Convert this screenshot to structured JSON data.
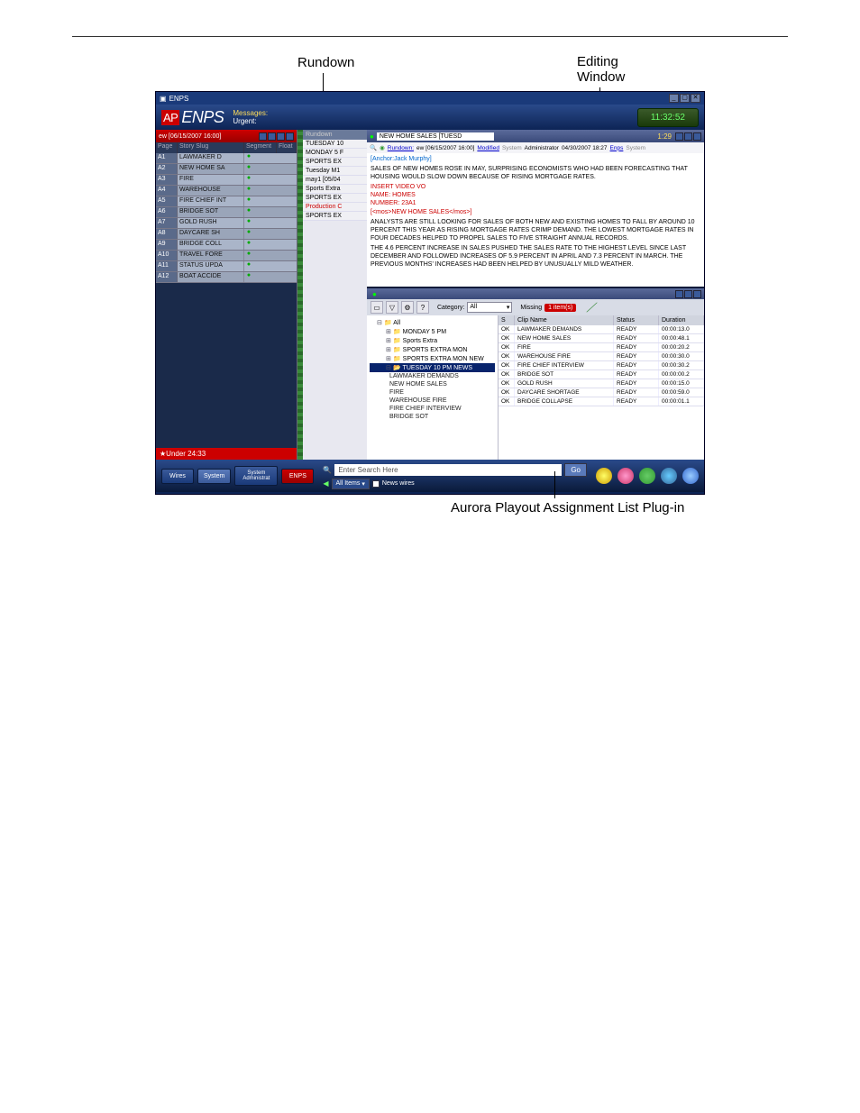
{
  "callouts": {
    "rundown": "Rundown",
    "editing_l1": "Editing",
    "editing_l2": "Window",
    "plugin": "Aurora Playout Assignment List Plug-in"
  },
  "titlebar": {
    "app": "ENPS"
  },
  "appbar": {
    "logo_ap": "AP",
    "logo_enps": "ENPS",
    "messages_label": "Messages:",
    "urgent_label": "Urgent:",
    "clock": "11:32:52"
  },
  "rundown": {
    "header": "ew [06/15/2007 16:00]",
    "cols": {
      "page": "Page",
      "slug": "Story Slug",
      "segment": "Segment",
      "float": "Float"
    },
    "rows": [
      {
        "page": "A1",
        "slug": "LAWMAKER D"
      },
      {
        "page": "A2",
        "slug": "NEW HOME SA"
      },
      {
        "page": "A3",
        "slug": "FIRE"
      },
      {
        "page": "A4",
        "slug": "WAREHOUSE"
      },
      {
        "page": "A5",
        "slug": "FIRE CHIEF INT"
      },
      {
        "page": "A6",
        "slug": "BRIDGE SOT"
      },
      {
        "page": "A7",
        "slug": "GOLD RUSH"
      },
      {
        "page": "A8",
        "slug": "DAYCARE SH"
      },
      {
        "page": "A9",
        "slug": "BRIDGE COLL"
      },
      {
        "page": "A10",
        "slug": "TRAVEL FORE"
      },
      {
        "page": "A11",
        "slug": "STATUS UPDA"
      },
      {
        "page": "A12",
        "slug": "BOAT ACCIDE"
      }
    ],
    "under": "Under 24:33"
  },
  "sidelist": {
    "head": "Rundown",
    "items": [
      {
        "label": "TUESDAY 10",
        "red": false
      },
      {
        "label": "MONDAY 5 F",
        "red": false
      },
      {
        "label": "SPORTS EX",
        "red": false
      },
      {
        "label": "Tuesday M1",
        "red": false
      },
      {
        "label": "may1 [05/04",
        "red": false
      },
      {
        "label": "Sports Extra",
        "red": false
      },
      {
        "label": "SPORTS EX",
        "red": false
      },
      {
        "label": "Production C",
        "red": true
      },
      {
        "label": "SPORTS EX",
        "red": false
      }
    ]
  },
  "editor": {
    "title": "NEW HOME SALES [TUESD",
    "duration": "1:29",
    "meta": {
      "rundowns": "Rundown:",
      "path": "ew [06/15/2007 16:00]",
      "modified": "Modified",
      "system": "System",
      "admin": "Administrator",
      "date": "04/30/2007 18:27",
      "enps": "Enps",
      "sys2": "System"
    },
    "anchor": "[Anchor:Jack Murphy]",
    "p1": "SALES OF NEW HOMES ROSE IN MAY, SURPRISING ECONOMISTS WHO HAD BEEN FORECASTING THAT HOUSING WOULD SLOW DOWN BECAUSE OF RISING MORTGAGE RATES.",
    "cue1": "INSERT VIDEO VO",
    "cue2": "NAME: HOMES",
    "cue3": "NUMBER: 23A1",
    "cue4": "[<mos>NEW HOME SALES</mos>]",
    "p2": "ANALYSTS ARE STILL LOOKING FOR SALES OF BOTH NEW AND EXISTING HOMES TO FALL BY AROUND 10 PERCENT THIS YEAR AS RISING MORTGAGE RATES CRIMP DEMAND. THE LOWEST MORTGAGE RATES IN FOUR DECADES HELPED TO PROPEL SALES TO FIVE STRAIGHT ANNUAL RECORDS.",
    "p3": "THE 4.6 PERCENT INCREASE IN SALES PUSHED THE SALES RATE TO THE HIGHEST LEVEL SINCE LAST DECEMBER AND FOLLOWED INCREASES OF 5.9 PERCENT IN APRIL AND 7.3 PERCENT IN MARCH. THE PREVIOUS MONTHS' INCREASES HAD BEEN HELPED BY UNUSUALLY MILD WEATHER."
  },
  "plugin": {
    "category_label": "Category:",
    "category_value": "All",
    "missing_label": "Missing",
    "missing_value": "1 item(s)",
    "tree": {
      "root": "All",
      "folders": [
        "MONDAY 5 PM",
        "Sports Extra",
        "SPORTS EXTRA MON",
        "SPORTS EXTRA MON NEW"
      ],
      "selected": "TUESDAY 10 PM NEWS",
      "children": [
        "LAWMAKER DEMANDS",
        "NEW HOME SALES",
        "FIRE",
        "WAREHOUSE FIRE",
        "FIRE CHIEF INTERVIEW",
        "BRIDGE SOT"
      ]
    },
    "cols": {
      "s": "S",
      "name": "Clip Name",
      "status": "Status",
      "duration": "Duration"
    },
    "clips": [
      {
        "s": "OK",
        "name": "LAWMAKER DEMANDS",
        "status": "READY",
        "dur": "00:00:13.0"
      },
      {
        "s": "OK",
        "name": "NEW HOME SALES",
        "status": "READY",
        "dur": "00:00:48.1"
      },
      {
        "s": "OK",
        "name": "FIRE",
        "status": "READY",
        "dur": "00:00:20.2"
      },
      {
        "s": "OK",
        "name": "WAREHOUSE FIRE",
        "status": "READY",
        "dur": "00:00:30.0"
      },
      {
        "s": "OK",
        "name": "FIRE CHIEF INTERVIEW",
        "status": "READY",
        "dur": "00:00:30.2"
      },
      {
        "s": "OK",
        "name": "BRIDGE SOT",
        "status": "READY",
        "dur": "00:00:00.2"
      },
      {
        "s": "OK",
        "name": "GOLD RUSH",
        "status": "READY",
        "dur": "00:00:15.0"
      },
      {
        "s": "OK",
        "name": "DAYCARE SHORTAGE",
        "status": "READY",
        "dur": "00:00:59.0"
      },
      {
        "s": "OK",
        "name": "BRIDGE COLLAPSE",
        "status": "READY",
        "dur": "00:00:01.1"
      }
    ]
  },
  "bottombar": {
    "tabs": [
      "Wires",
      "System",
      "System Administrat",
      "ENPS"
    ],
    "search_placeholder": "Enter Search Here",
    "go": "Go",
    "filter1": "All Items",
    "filter2": "News wires"
  }
}
